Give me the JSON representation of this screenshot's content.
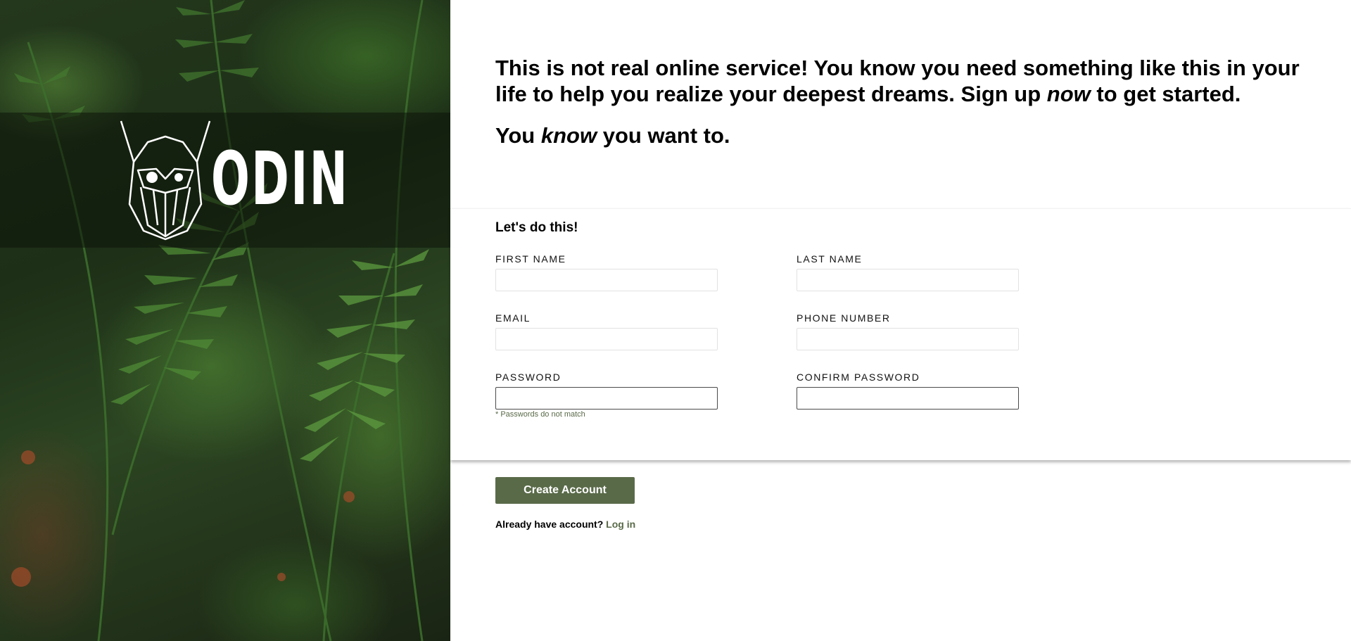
{
  "brand": {
    "name": "ODIN"
  },
  "intro": {
    "line1_a": "This is not real online service! You know you need something like this in your life to help you realize your deepest dreams. Sign up ",
    "line1_em": "now",
    "line1_b": " to get started.",
    "line2_a": "You ",
    "line2_em": "know",
    "line2_b": " you want to."
  },
  "form": {
    "heading": "Let's do this!",
    "fields": {
      "first_name": {
        "label": "First Name",
        "value": ""
      },
      "last_name": {
        "label": "Last Name",
        "value": ""
      },
      "email": {
        "label": "Email",
        "value": ""
      },
      "phone": {
        "label": "Phone Number",
        "value": ""
      },
      "password": {
        "label": "Password",
        "value": "",
        "error": "* Passwords do not match"
      },
      "confirm_password": {
        "label": "Confirm Password",
        "value": ""
      }
    }
  },
  "actions": {
    "submit_label": "Create Account",
    "login_prompt": "Already have account?",
    "login_link": "Log in"
  },
  "colors": {
    "accent": "#596a48",
    "hero_dark": "#1d2f17"
  },
  "icons": {
    "logo": "viking-helmet-logo-icon"
  }
}
